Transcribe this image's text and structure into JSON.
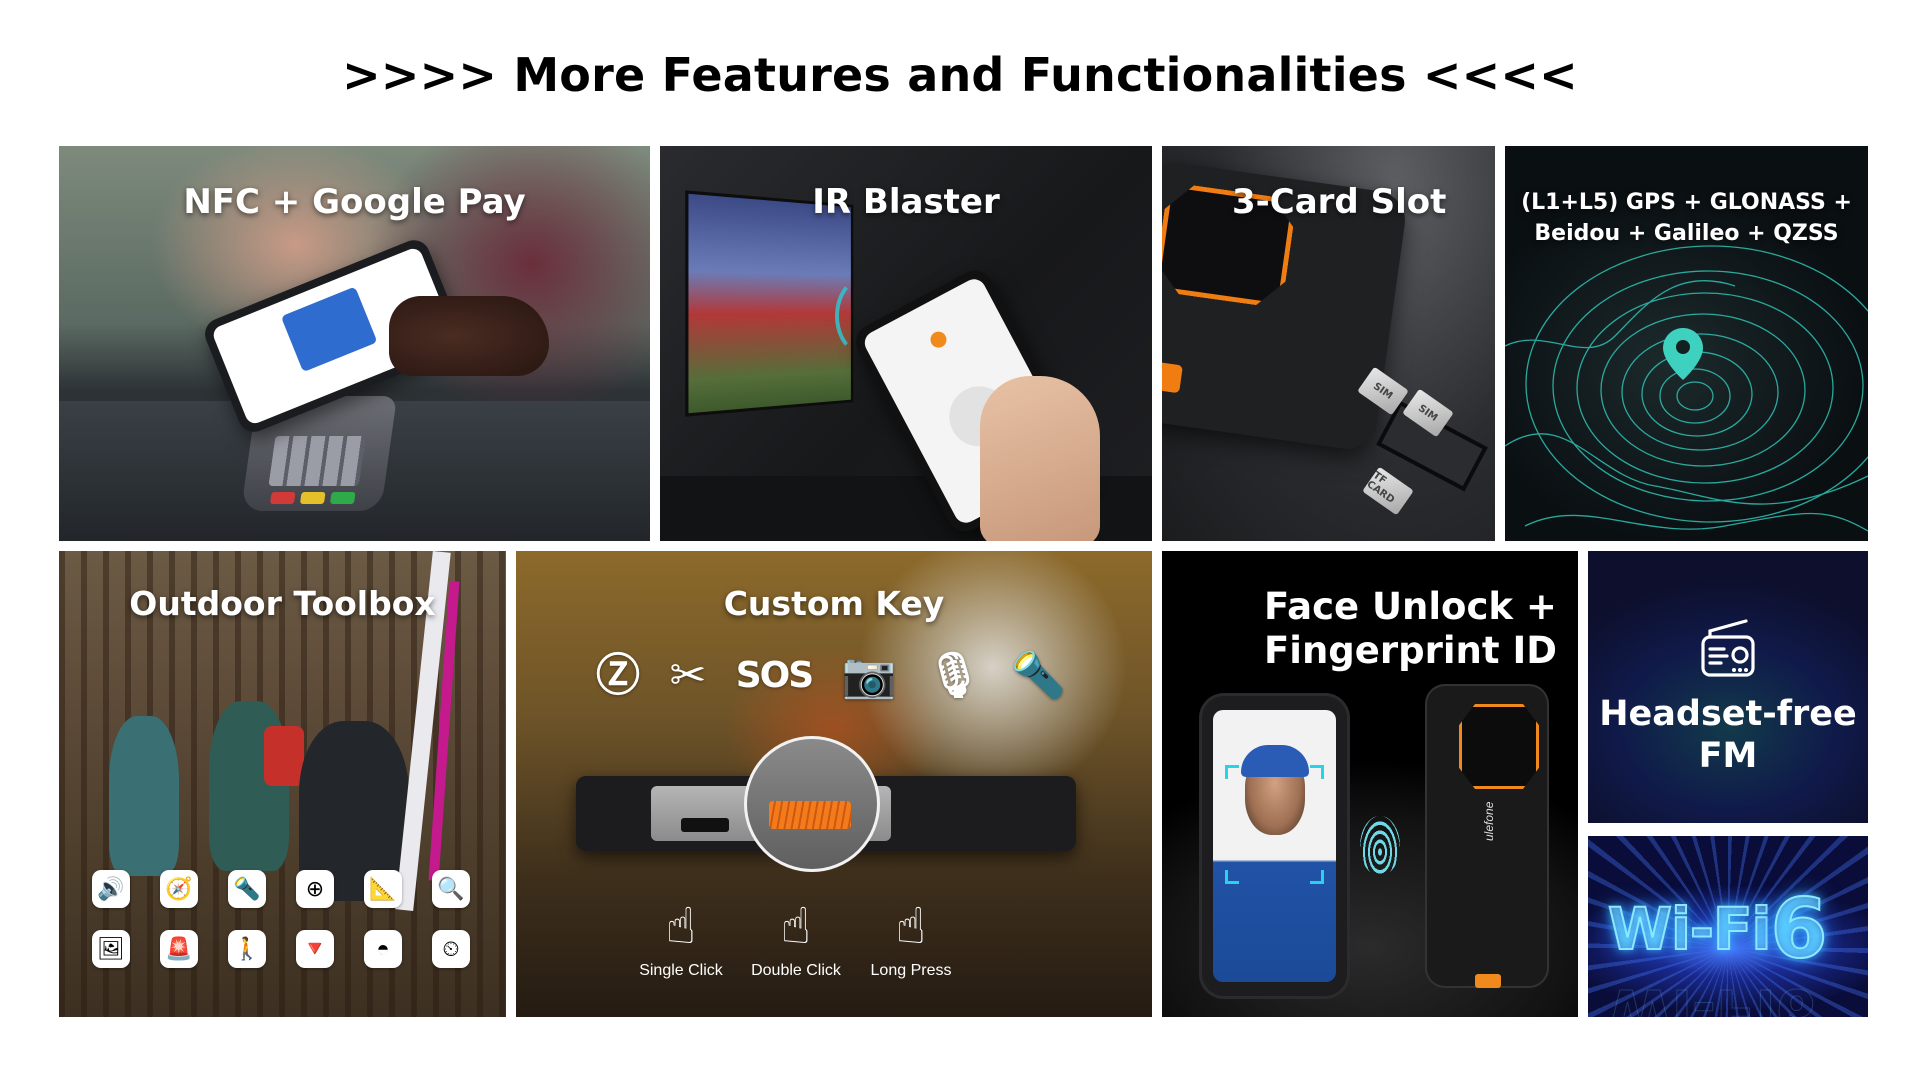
{
  "header": {
    "title": ">>>> More Features and Functionalities <<<<"
  },
  "tiles": {
    "nfc": {
      "title": "NFC + Google Pay"
    },
    "ir": {
      "title": "IR Blaster"
    },
    "card_slot": {
      "title": "3-Card Slot",
      "cards": [
        "SIM",
        "SIM",
        "TF CARD"
      ]
    },
    "gps": {
      "title_line1": "(L1+L5) GPS + GLONASS +",
      "title_line2": "Beidou + Galileo + QZSS",
      "accent_color": "#3fd1c0",
      "icon": "map-pin-icon"
    },
    "outdoor": {
      "title": "Outdoor Toolbox",
      "apps": [
        {
          "name": "sound-meter-icon",
          "glyph": "🔊"
        },
        {
          "name": "compass-icon",
          "glyph": "🧭"
        },
        {
          "name": "flashlight-icon",
          "glyph": "🔦"
        },
        {
          "name": "crosshair-level-icon",
          "glyph": "⊕"
        },
        {
          "name": "ruler-icon",
          "glyph": "📐"
        },
        {
          "name": "magnifier-icon",
          "glyph": "🔍"
        },
        {
          "name": "picture-frame-icon",
          "glyph": "🖼"
        },
        {
          "name": "alarm-light-icon",
          "glyph": "🚨"
        },
        {
          "name": "pedometer-icon",
          "glyph": "🚶"
        },
        {
          "name": "plumb-bob-icon",
          "glyph": "🔻"
        },
        {
          "name": "protractor-icon",
          "glyph": "◓"
        },
        {
          "name": "barometer-icon",
          "glyph": "⏲"
        }
      ]
    },
    "custom_key": {
      "title": "Custom Key",
      "functions": [
        {
          "name": "z-app-icon",
          "glyph": "Ⓩ"
        },
        {
          "name": "scissors-icon",
          "glyph": "✂"
        },
        {
          "name": "sos-icon",
          "glyph": "SOS"
        },
        {
          "name": "underwater-camera-icon",
          "glyph": "📷"
        },
        {
          "name": "microphone-icon",
          "glyph": "🎙"
        },
        {
          "name": "flashlight-icon",
          "glyph": "🔦"
        }
      ],
      "gestures": [
        {
          "name": "single-click",
          "label": "Single Click",
          "glyph": "☝"
        },
        {
          "name": "double-click",
          "label": "Double Click",
          "glyph": "☝"
        },
        {
          "name": "long-press",
          "label": "Long Press",
          "glyph": "☝"
        }
      ],
      "accent_color": "#f47a1c"
    },
    "face": {
      "title_line1": "Face Unlock +",
      "title_line2": "Fingerprint ID",
      "brand": "ulefone"
    },
    "fm": {
      "title_line1": "Headset-free",
      "title_line2": "FM",
      "icon": "radio-icon"
    },
    "wifi": {
      "label_main": "Wi-Fi",
      "label_version": "6"
    }
  }
}
